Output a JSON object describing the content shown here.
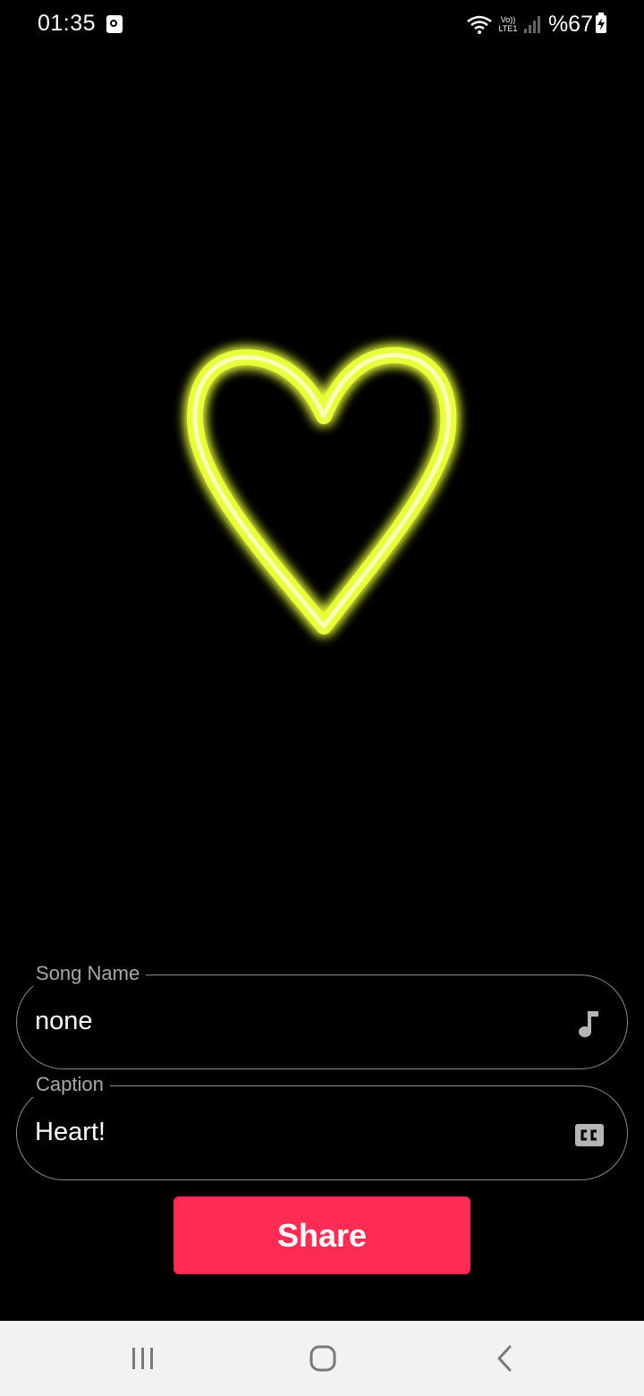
{
  "status_bar": {
    "time": "01:35",
    "volte_line1": "Vo))",
    "volte_line2": "LTE1",
    "battery": "%67",
    "icons": [
      "notification-icon",
      "wifi-icon",
      "volte-icon",
      "signal-icon",
      "battery-charging-icon"
    ]
  },
  "artwork": {
    "shape": "heart",
    "color": "#e8ff3a"
  },
  "song_field": {
    "label": "Song Name",
    "value": "none",
    "icon": "music-note-icon"
  },
  "caption_field": {
    "label": "Caption",
    "value": "Heart!",
    "icon": "closed-caption-icon"
  },
  "share_button": {
    "label": "Share",
    "color": "#fe2c55"
  },
  "nav_bar": {
    "icons": [
      "recents-icon",
      "home-icon",
      "back-icon"
    ]
  }
}
